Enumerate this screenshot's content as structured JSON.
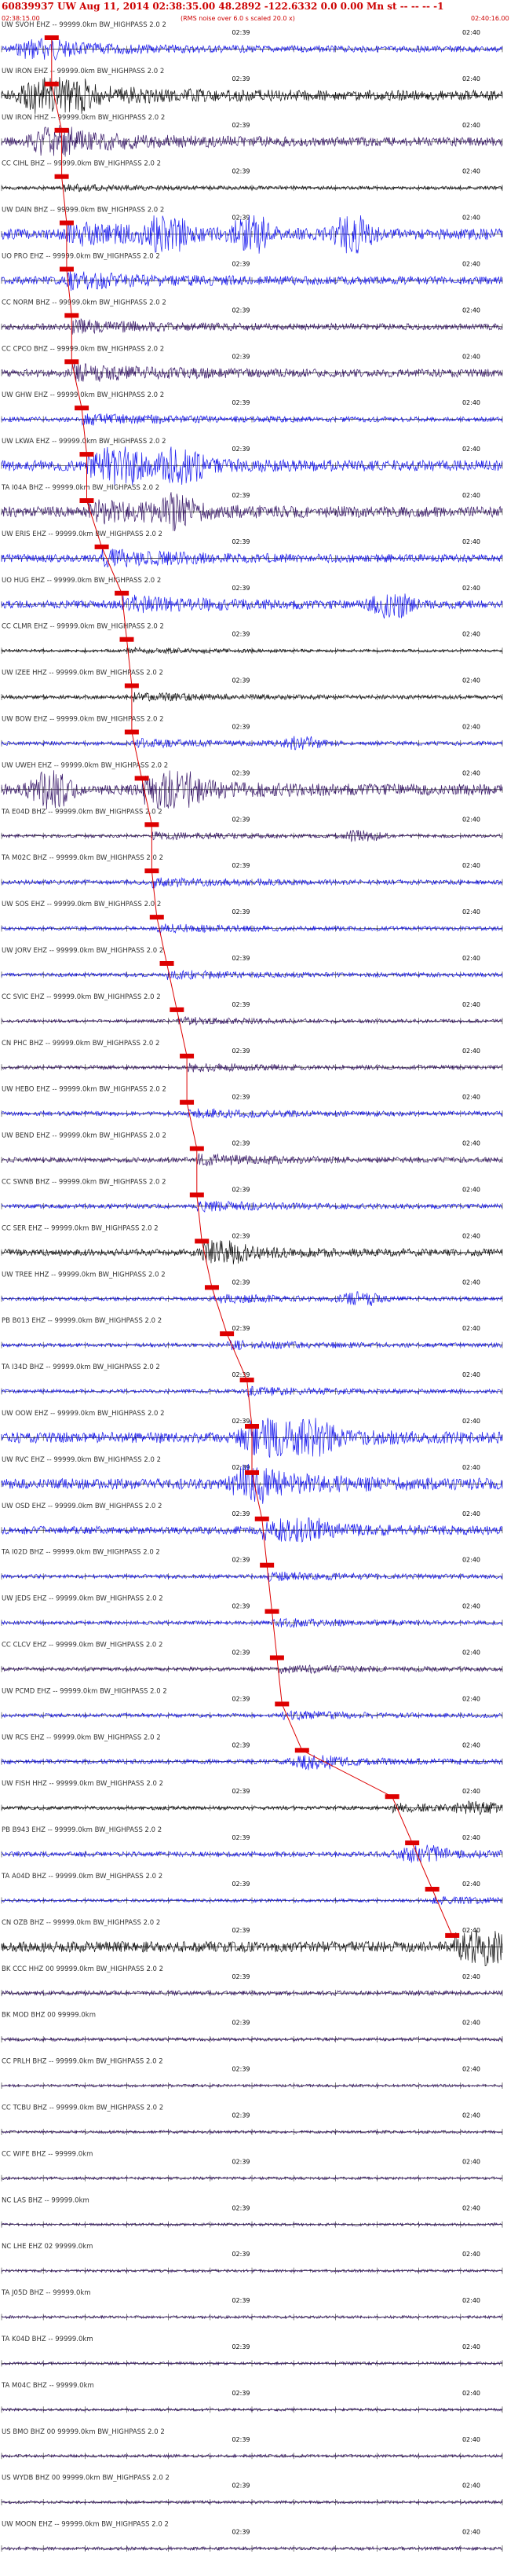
{
  "header": {
    "title": "60839937 UW Aug 11, 2014 02:38:35.00   48.2892 -122.6332  0.0 0.00 Mn st -- -- -- -1",
    "subtitle": "(RMS noise over 6.0 s scaled 20.0 x)",
    "time_start": "02:38:15.00",
    "time_end": "02:40:16.00"
  },
  "colors": {
    "header_red": "#cc0000",
    "pick_red": "#dd0000",
    "trace_blue": "#1a1aee",
    "trace_black": "#111111",
    "trace_purple": "#3a1a6a",
    "label": "#333333"
  },
  "chart_data": {
    "type": "line",
    "x_range_utc": [
      "02:38:15.00",
      "02:40:16.00"
    ],
    "tick_labels": [
      "02:39",
      "02:40"
    ],
    "series": [
      {
        "name": "UW SVOH EHZ -- 99999.0km BW_HIGHPASS  2.0  2",
        "color": "blue",
        "amp": 0.55,
        "pick": 0.1,
        "bursts": [
          0.07
        ]
      },
      {
        "name": "UW IRON EHZ -- 99999.0km BW_HIGHPASS  2.0  2",
        "color": "black",
        "amp": 0.9,
        "pick": 0.1,
        "bursts": [
          0.08,
          0.13
        ]
      },
      {
        "name": "UW IRON HHZ -- 99999.0km BW_HIGHPASS  2.0  2",
        "color": "purple",
        "amp": 0.8,
        "pick": 0.12,
        "bursts": [
          0.1
        ]
      },
      {
        "name": "CC CIHL BHZ -- 99999.0km BW_HIGHPASS  2.0  2",
        "color": "black",
        "amp": 0.3,
        "pick": 0.12,
        "bursts": []
      },
      {
        "name": "UW DAIN BHZ -- 99999.0km BW_HIGHPASS  2.0  2",
        "color": "blue",
        "amp": 0.95,
        "pick": 0.13,
        "bursts": [
          0.33,
          0.5,
          0.7
        ]
      },
      {
        "name": "UO PRO EHZ -- 99999.0km BW_HIGHPASS  2.0  2",
        "color": "blue",
        "amp": 0.7,
        "pick": 0.13,
        "bursts": []
      },
      {
        "name": "CC NORM BHZ -- 99999.0km BW_HIGHPASS  2.0  2",
        "color": "purple",
        "amp": 0.55,
        "pick": 0.14,
        "bursts": []
      },
      {
        "name": "CC CPCO BHZ -- 99999.0km BW_HIGHPASS  2.0  2",
        "color": "purple",
        "amp": 0.7,
        "pick": 0.14,
        "bursts": []
      },
      {
        "name": "UW GHW EHZ -- 99999.0km BW_HIGHPASS  2.0  2",
        "color": "blue",
        "amp": 0.45,
        "pick": 0.16,
        "bursts": []
      },
      {
        "name": "UW LKWA EHZ -- 99999.0km BW_HIGHPASS  2.0  2",
        "color": "blue",
        "amp": 0.95,
        "pick": 0.17,
        "bursts": [
          0.24,
          0.36
        ]
      },
      {
        "name": "TA I04A BHZ -- 99999.0km BW_HIGHPASS  2.0  2",
        "color": "purple",
        "amp": 0.95,
        "pick": 0.17,
        "bursts": [
          0.35
        ]
      },
      {
        "name": "UW ERIS EHZ -- 99999.0km BW_HIGHPASS  2.0  2",
        "color": "blue",
        "amp": 0.7,
        "pick": 0.2,
        "bursts": []
      },
      {
        "name": "UO HUG EHZ -- 99999.0km BW_HIGHPASS  2.0  2",
        "color": "blue",
        "amp": 0.7,
        "pick": 0.24,
        "bursts": [
          0.78
        ]
      },
      {
        "name": "CC CLMR EHZ -- 99999.0km BW_HIGHPASS  2.0  2",
        "color": "black",
        "amp": 0.25,
        "pick": 0.25,
        "bursts": []
      },
      {
        "name": "UW IZEE HHZ -- 99999.0km BW_HIGHPASS  2.0  2",
        "color": "black",
        "amp": 0.35,
        "pick": 0.26,
        "bursts": []
      },
      {
        "name": "UW BOW EHZ -- 99999.0km BW_HIGHPASS  2.0  2",
        "color": "blue",
        "amp": 0.35,
        "pick": 0.26,
        "bursts": [
          0.6
        ]
      },
      {
        "name": "UW UWEH EHZ -- 99999.0km BW_HIGHPASS  2.0  2",
        "color": "purple",
        "amp": 0.95,
        "pick": 0.28,
        "bursts": [
          0.1,
          0.35
        ]
      },
      {
        "name": "TA E04D BHZ -- 99999.0km BW_HIGHPASS  2.0  2",
        "color": "purple",
        "amp": 0.3,
        "pick": 0.3,
        "bursts": [
          0.72
        ]
      },
      {
        "name": "TA M02C BHZ -- 99999.0km BW_HIGHPASS  2.0  2",
        "color": "blue",
        "amp": 0.4,
        "pick": 0.3,
        "bursts": []
      },
      {
        "name": "UW SOS EHZ -- 99999.0km BW_HIGHPASS  2.0  2",
        "color": "blue",
        "amp": 0.35,
        "pick": 0.31,
        "bursts": []
      },
      {
        "name": "UW JORV EHZ -- 99999.0km BW_HIGHPASS  2.0  2",
        "color": "blue",
        "amp": 0.35,
        "pick": 0.33,
        "bursts": []
      },
      {
        "name": "CC SVIC EHZ -- 99999.0km BW_HIGHPASS  2.0  2",
        "color": "purple",
        "amp": 0.3,
        "pick": 0.35,
        "bursts": []
      },
      {
        "name": "CN PHC BHZ -- 99999.0km BW_HIGHPASS  2.0  2",
        "color": "purple",
        "amp": 0.35,
        "pick": 0.37,
        "bursts": []
      },
      {
        "name": "UW HEBO EHZ -- 99999.0km BW_HIGHPASS  2.0  2",
        "color": "blue",
        "amp": 0.4,
        "pick": 0.37,
        "bursts": []
      },
      {
        "name": "UW BEND EHZ -- 99999.0km BW_HIGHPASS  2.0  2",
        "color": "purple",
        "amp": 0.45,
        "pick": 0.39,
        "bursts": []
      },
      {
        "name": "CC SWNB BHZ -- 99999.0km BW_HIGHPASS  2.0  2",
        "color": "blue",
        "amp": 0.4,
        "pick": 0.39,
        "bursts": []
      },
      {
        "name": "CC SER EHZ -- 99999.0km BW_HIGHPASS  2.0  2",
        "color": "black",
        "amp": 0.6,
        "pick": 0.4,
        "bursts": [
          0.45
        ]
      },
      {
        "name": "UW TREE HHZ -- 99999.0km BW_HIGHPASS  2.0  2",
        "color": "blue",
        "amp": 0.35,
        "pick": 0.42,
        "bursts": [
          0.72
        ]
      },
      {
        "name": "PB B013 EHZ -- 99999.0km BW_HIGHPASS  2.0  2",
        "color": "blue",
        "amp": 0.35,
        "pick": 0.45,
        "bursts": []
      },
      {
        "name": "TA I34D BHZ -- 99999.0km BW_HIGHPASS  2.0  2",
        "color": "blue",
        "amp": 0.35,
        "pick": 0.49,
        "bursts": []
      },
      {
        "name": "UW OOW EHZ -- 99999.0km BW_HIGHPASS  2.0  2",
        "color": "blue",
        "amp": 0.95,
        "pick": 0.5,
        "bursts": [
          0.52,
          0.62
        ]
      },
      {
        "name": "UW RVC EHZ -- 99999.0km BW_HIGHPASS  2.0  2",
        "color": "blue",
        "amp": 0.95,
        "pick": 0.5,
        "bursts": [
          0.5
        ]
      },
      {
        "name": "UW OSD EHZ -- 99999.0km BW_HIGHPASS  2.0  2",
        "color": "blue",
        "amp": 0.7,
        "pick": 0.52,
        "bursts": [
          0.6
        ]
      },
      {
        "name": "TA I02D BHZ -- 99999.0km BW_HIGHPASS  2.0  2",
        "color": "blue",
        "amp": 0.35,
        "pick": 0.53,
        "bursts": []
      },
      {
        "name": "UW JEDS EHZ -- 99999.0km BW_HIGHPASS  2.0  2",
        "color": "blue",
        "amp": 0.35,
        "pick": 0.54,
        "bursts": []
      },
      {
        "name": "CC CLCV EHZ -- 99999.0km BW_HIGHPASS  2.0  2",
        "color": "purple",
        "amp": 0.35,
        "pick": 0.55,
        "bursts": []
      },
      {
        "name": "UW PCMD EHZ -- 99999.0km BW_HIGHPASS  2.0  2",
        "color": "blue",
        "amp": 0.35,
        "pick": 0.56,
        "bursts": []
      },
      {
        "name": "UW RCS EHZ -- 99999.0km BW_HIGHPASS  2.0  2",
        "color": "blue",
        "amp": 0.4,
        "pick": 0.6,
        "bursts": [
          0.62
        ]
      },
      {
        "name": "UW FISH HHZ -- 99999.0km BW_HIGHPASS  2.0  2",
        "color": "black",
        "amp": 0.35,
        "pick": 0.78,
        "bursts": [
          0.95
        ]
      },
      {
        "name": "PB B943 EHZ -- 99999.0km BW_HIGHPASS  2.0  2",
        "color": "blue",
        "amp": 0.45,
        "pick": 0.82,
        "bursts": [
          0.83
        ]
      },
      {
        "name": "TA A04D BHZ -- 99999.0km BW_HIGHPASS  2.0  2",
        "color": "blue",
        "amp": 0.3,
        "pick": 0.86,
        "bursts": []
      },
      {
        "name": "CN OZB BHZ -- 99999.0km BW_HIGHPASS  2.0  2",
        "color": "black",
        "amp": 0.95,
        "pick": 0.9,
        "bursts": [
          0.98
        ]
      },
      {
        "name": "BK CCC HHZ 00 99999.0km BW_HIGHPASS  2.0  2",
        "color": "purple",
        "amp": 0.4,
        "pick": null,
        "bursts": []
      },
      {
        "name": "BK MOD BHZ 00 99999.0km",
        "color": "purple",
        "amp": 0.3,
        "pick": null,
        "bursts": []
      },
      {
        "name": "CC PRLH BHZ -- 99999.0km BW_HIGHPASS  2.0  2",
        "color": "purple",
        "amp": 0.25,
        "pick": null,
        "bursts": []
      },
      {
        "name": "CC TCBU BHZ -- 99999.0km BW_HIGHPASS  2.0  2",
        "color": "purple",
        "amp": 0.25,
        "pick": null,
        "bursts": []
      },
      {
        "name": "CC WIFE BHZ -- 99999.0km",
        "color": "purple",
        "amp": 0.25,
        "pick": null,
        "bursts": []
      },
      {
        "name": "NC LAS BHZ -- 99999.0km",
        "color": "purple",
        "amp": 0.25,
        "pick": null,
        "bursts": []
      },
      {
        "name": "NC LHE EHZ 02 99999.0km",
        "color": "purple",
        "amp": 0.25,
        "pick": null,
        "bursts": []
      },
      {
        "name": "TA J05D BHZ -- 99999.0km",
        "color": "purple",
        "amp": 0.25,
        "pick": null,
        "bursts": []
      },
      {
        "name": "TA K04D BHZ -- 99999.0km",
        "color": "purple",
        "amp": 0.25,
        "pick": null,
        "bursts": []
      },
      {
        "name": "TA M04C BHZ -- 99999.0km",
        "color": "purple",
        "amp": 0.25,
        "pick": null,
        "bursts": []
      },
      {
        "name": "US BMO BHZ 00 99999.0km BW_HIGHPASS  2.0  2",
        "color": "purple",
        "amp": 0.25,
        "pick": null,
        "bursts": []
      },
      {
        "name": "US WYDB BHZ 00 99999.0km BW_HIGHPASS  2.0  2",
        "color": "purple",
        "amp": 0.25,
        "pick": null,
        "bursts": []
      },
      {
        "name": "UW MOON EHZ -- 99999.0km BW_HIGHPASS  2.0  2",
        "color": "purple",
        "amp": 0.3,
        "pick": null,
        "bursts": []
      }
    ]
  }
}
